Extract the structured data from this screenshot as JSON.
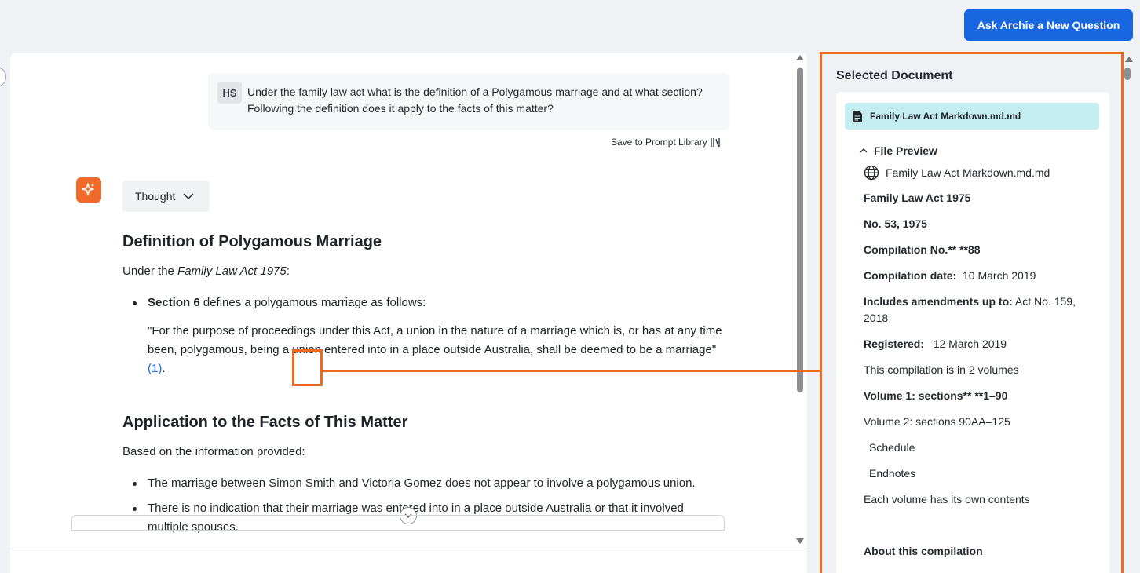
{
  "header": {
    "ask_button": "Ask Archie a New Question"
  },
  "user_message": {
    "initials": "HS",
    "text": "Under the family law act what is the definition of a Polygamous marriage and at what section? Following the definition does it apply to the facts of this matter?",
    "save_prompt": "Save to Prompt Library"
  },
  "response": {
    "thought_label": "Thought",
    "heading1": "Definition of Polygamous Marriage",
    "intro_prefix": "Under the ",
    "intro_act": "Family Law Act 1975",
    "intro_suffix": ":",
    "bullet1_bold": "Section 6",
    "bullet1_rest": " defines a polygamous marriage as follows:",
    "quote": "\"For the purpose of proceedings under this Act, a union in the nature of a marriage which is, or has at any time been, polygamous, being a union entered into in a place outside Australia, shall be deemed to be a marriage\"",
    "citation": "(1)",
    "quote_end": ".",
    "heading2": "Application to the Facts of This Matter",
    "based_on": "Based on the information provided:",
    "bullets": [
      "The marriage between Simon Smith and Victoria Gomez does not appear to involve a polygamous union.",
      "There is no indication that their marriage was entered into in a place outside Australia or that it involved multiple spouses."
    ]
  },
  "selected_document": {
    "title": "Selected Document",
    "file_name": "Family Law Act Markdown.md.md",
    "preview_label": "File Preview",
    "preview_file": "Family Law Act Markdown.md.md",
    "lines": {
      "act": "Family Law Act 1975",
      "number": "No. 53, 1975",
      "compilation_no": "Compilation No.** **88",
      "compilation_date_label": "Compilation date:",
      "compilation_date_value": "  10 March 2019",
      "amendments_label": "Includes amendments up to:",
      "amendments_value": " Act No. 159, 2018",
      "registered_label": "Registered:",
      "registered_value": "   12 March 2019",
      "volumes": "This compilation is in 2 volumes",
      "volume1": "Volume 1: sections** **1–90",
      "volume2": "Volume 2: sections 90AA–125",
      "schedule": "Schedule",
      "endnotes": "Endnotes",
      "contents": "Each volume has its own contents",
      "about": "About this compilation"
    }
  },
  "colors": {
    "accent_orange": "#ef6a1d",
    "primary_blue": "#1867e0",
    "chip_cyan": "#c3edf1"
  }
}
